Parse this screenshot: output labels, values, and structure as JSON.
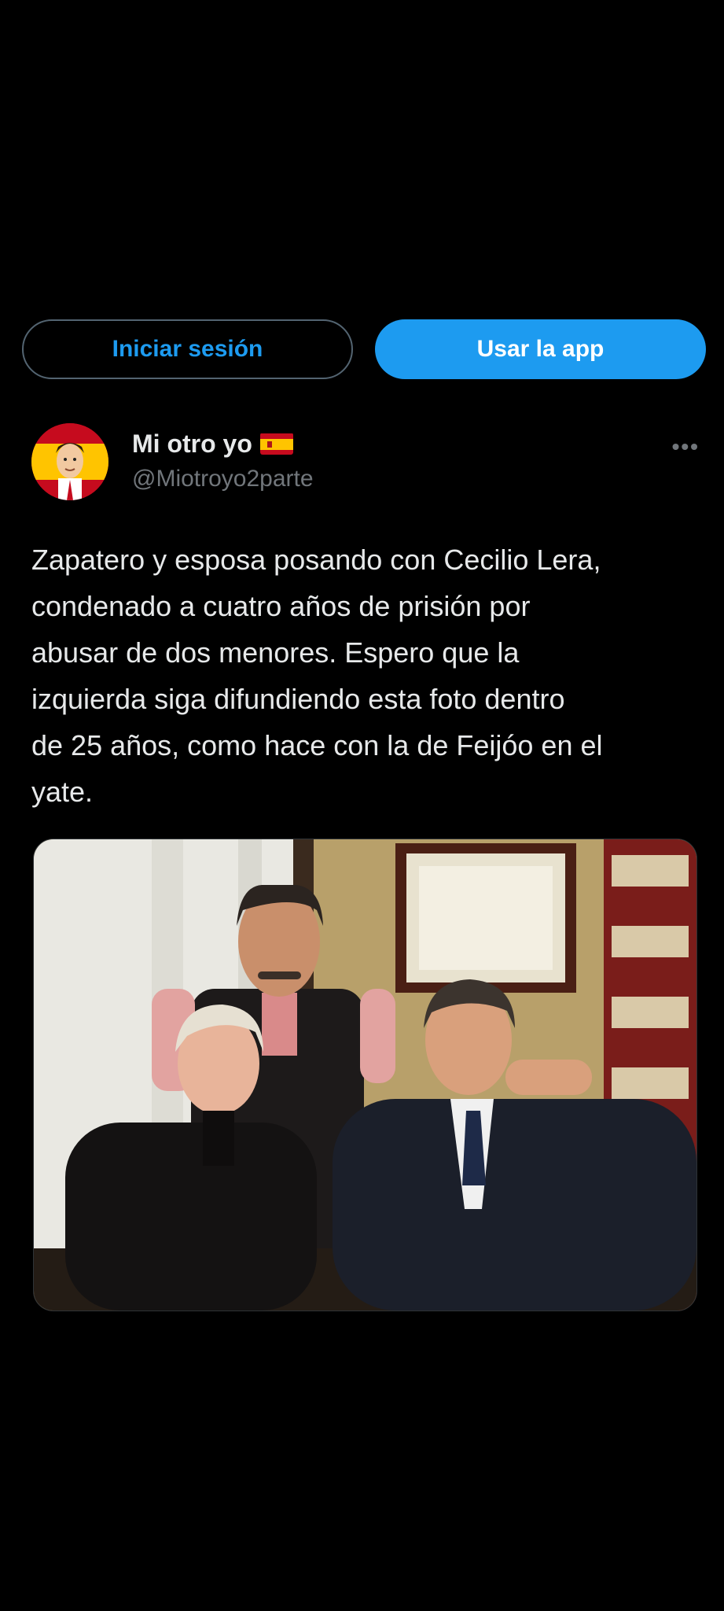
{
  "auth": {
    "login_label": "Iniciar sesión",
    "app_label": "Usar la app"
  },
  "tweet": {
    "display_name": "Mi otro yo",
    "handle": "@Miotroyo2parte",
    "more_label": "•••",
    "text": "Zapatero y esposa posando con Cecilio Lera,\ncondenado a cuatro años de prisión por\nabusar de dos menores. Espero que la\nizquierda siga difundiendo esta foto dentro\nde 25 años, como hace con la de Feijóo en el\nyate."
  },
  "colors": {
    "background": "#000000",
    "accent": "#1d9bf0",
    "text_primary": "#e7e9ea",
    "text_secondary": "#71767b",
    "border": "#536471"
  },
  "icons": {
    "flag": "spain-flag-icon",
    "more": "more-options-icon"
  }
}
